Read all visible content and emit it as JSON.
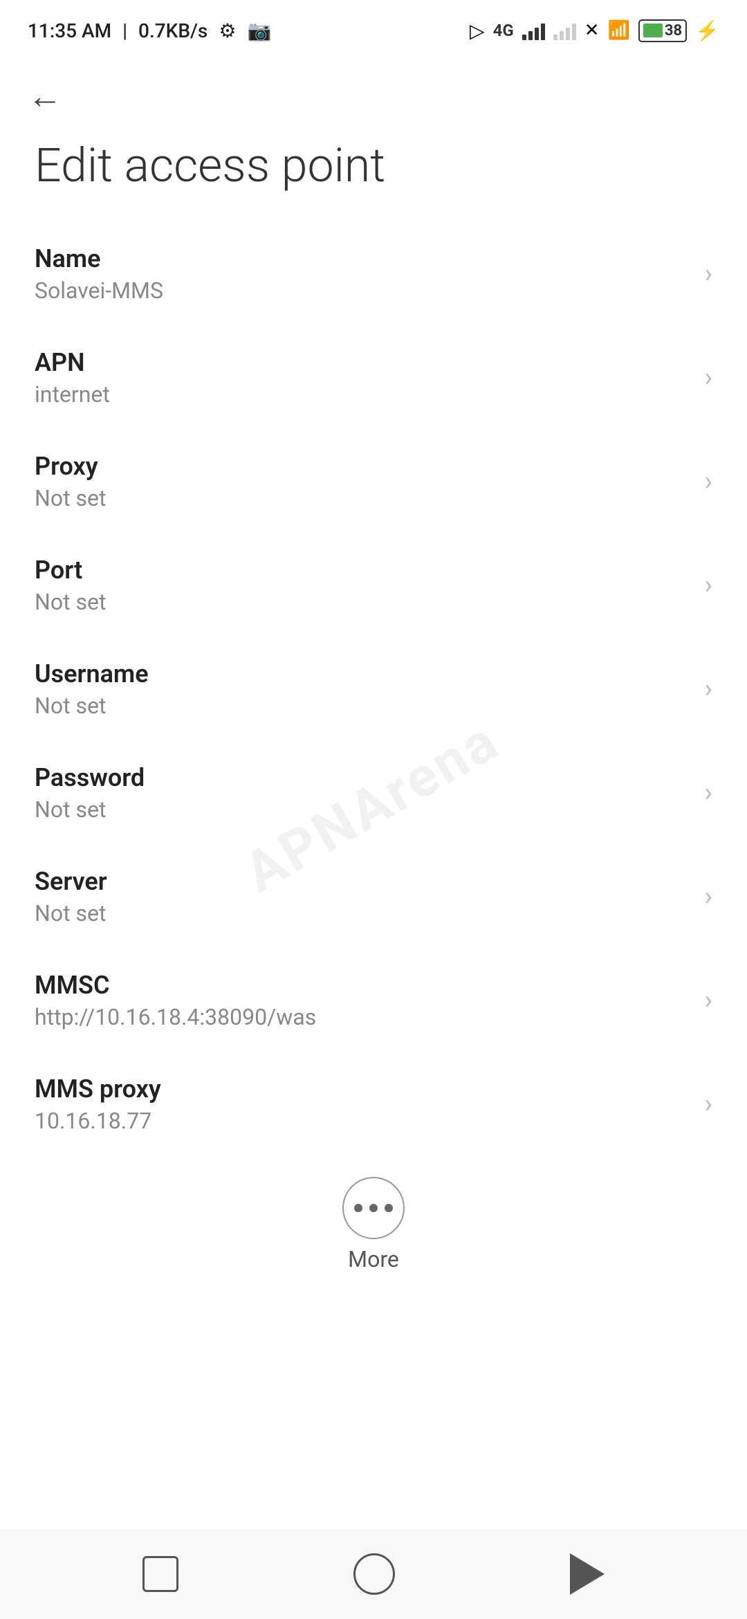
{
  "statusBar": {
    "time": "11:35 AM",
    "speed": "0.7KB/s",
    "battery": "38"
  },
  "page": {
    "title": "Edit access point",
    "backLabel": "←"
  },
  "settings": [
    {
      "label": "Name",
      "value": "Solavei-MMS"
    },
    {
      "label": "APN",
      "value": "internet"
    },
    {
      "label": "Proxy",
      "value": "Not set"
    },
    {
      "label": "Port",
      "value": "Not set"
    },
    {
      "label": "Username",
      "value": "Not set"
    },
    {
      "label": "Password",
      "value": "Not set"
    },
    {
      "label": "Server",
      "value": "Not set"
    },
    {
      "label": "MMSC",
      "value": "http://10.16.18.4:38090/was"
    },
    {
      "label": "MMS proxy",
      "value": "10.16.18.77"
    }
  ],
  "more": {
    "label": "More"
  },
  "watermark": "APNArena"
}
